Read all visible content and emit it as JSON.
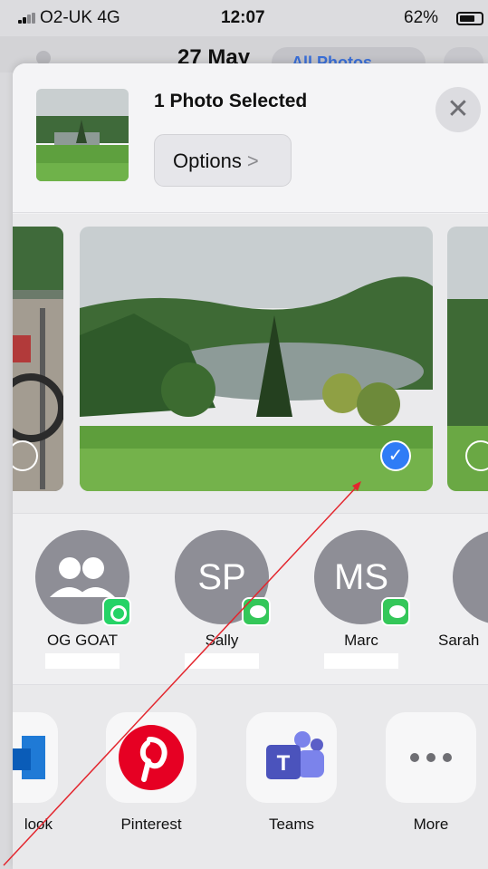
{
  "status_bar": {
    "carrier": "O2-UK  4G",
    "time": "12:07",
    "battery": "62%"
  },
  "background": {
    "date": "27 May",
    "pill_label": "All Photos"
  },
  "share_sheet": {
    "title": "1 Photo Selected",
    "options_label": "Options",
    "options_chevron": ">",
    "close_icon": "✕",
    "check_glyph": "✓",
    "people": [
      {
        "initials": "",
        "name": "OG GOAT",
        "app": "whatsapp"
      },
      {
        "initials": "SP",
        "name": "Sally",
        "app": "messages"
      },
      {
        "initials": "MS",
        "name": "Marc",
        "app": "messages"
      },
      {
        "initials": "",
        "name": "Sarah",
        "app": "messages"
      }
    ],
    "apps": [
      {
        "name": "look",
        "icon": "outlook-icon"
      },
      {
        "name": "Pinterest",
        "icon": "pinterest-icon"
      },
      {
        "name": "Teams",
        "icon": "teams-icon"
      },
      {
        "name": "More",
        "icon": "more-icon"
      }
    ]
  },
  "colors": {
    "selection_blue": "#2f7cf6",
    "pinterest_red": "#e60023",
    "teams_purple": "#5b5fc7",
    "messages_green": "#34c759"
  }
}
